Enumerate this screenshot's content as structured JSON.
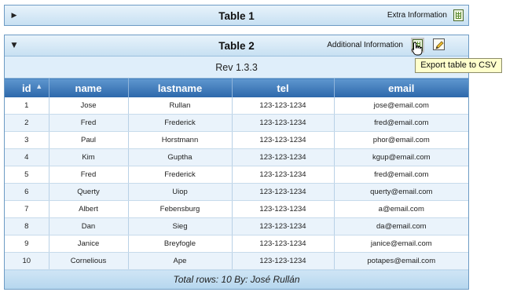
{
  "table1": {
    "title": "Table 1",
    "extra_label": "Extra Information",
    "toggle_icon": "triangle-right"
  },
  "table2": {
    "title": "Table 2",
    "extra_label": "Additional Information",
    "toggle_icon": "triangle-down",
    "caption": "Rev 1.3.3",
    "tooltip": "Export table to CSV",
    "columns": [
      "id",
      "name",
      "lastname",
      "tel",
      "email"
    ],
    "sort_column": "id",
    "sort_direction": "ascending",
    "rows": [
      {
        "id": "1",
        "name": "Jose",
        "lastname": "Rullan",
        "tel": "123-123-1234",
        "email": "jose@email.com"
      },
      {
        "id": "2",
        "name": "Fred",
        "lastname": "Frederick",
        "tel": "123-123-1234",
        "email": "fred@email.com"
      },
      {
        "id": "3",
        "name": "Paul",
        "lastname": "Horstmann",
        "tel": "123-123-1234",
        "email": "phor@email.com"
      },
      {
        "id": "4",
        "name": "Kim",
        "lastname": "Guptha",
        "tel": "123-123-1234",
        "email": "kgup@email.com"
      },
      {
        "id": "5",
        "name": "Fred",
        "lastname": "Frederick",
        "tel": "123-123-1234",
        "email": "fred@email.com"
      },
      {
        "id": "6",
        "name": "Querty",
        "lastname": "Uiop",
        "tel": "123-123-1234",
        "email": "querty@email.com"
      },
      {
        "id": "7",
        "name": "Albert",
        "lastname": "Febensburg",
        "tel": "123-123-1234",
        "email": "a@email.com"
      },
      {
        "id": "8",
        "name": "Dan",
        "lastname": "Sieg",
        "tel": "123-123-1234",
        "email": "da@email.com"
      },
      {
        "id": "9",
        "name": "Janice",
        "lastname": "Breyfogle",
        "tel": "123-123-1234",
        "email": "janice@email.com"
      },
      {
        "id": "10",
        "name": "Cornelious",
        "lastname": "Ape",
        "tel": "123-123-1234",
        "email": "potapes@email.com"
      }
    ],
    "footer": "Total rows: 10 By: José Rullán"
  },
  "icons": {
    "export": "spreadsheet-icon",
    "edit": "pencil-icon",
    "cursor": "hand-pointer-icon"
  },
  "colors": {
    "header_gradient_top": "#5f97cf",
    "header_gradient_bottom": "#2c67aa",
    "panel_border": "#6d9bc4",
    "tooltip_background": "#ffffcc"
  }
}
